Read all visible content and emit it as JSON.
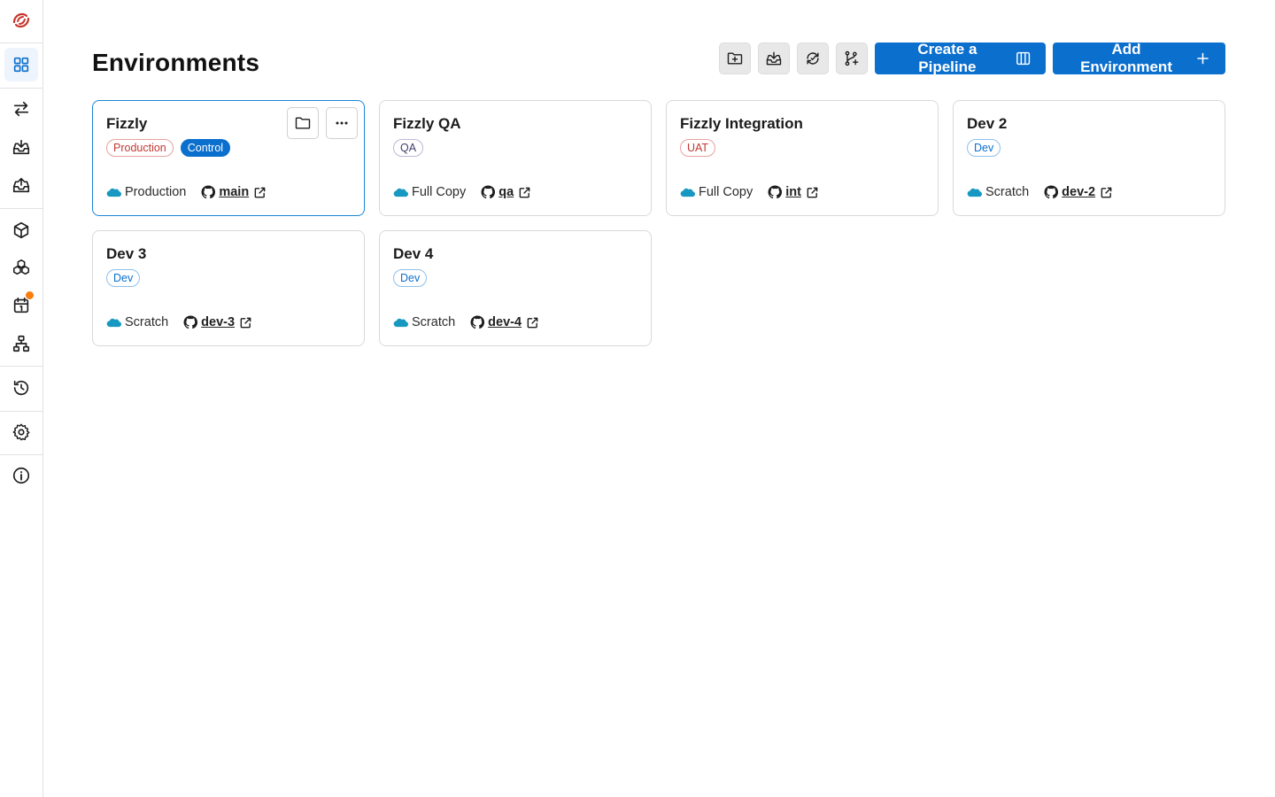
{
  "page": {
    "title": "Environments"
  },
  "sidebar": {
    "items": [
      {
        "name": "environments",
        "icon": "grid-icon",
        "active": true
      },
      {
        "name": "compare",
        "icon": "arrows-swap-icon"
      },
      {
        "name": "retrieve",
        "icon": "inbox-in-icon"
      },
      {
        "name": "deploy",
        "icon": "inbox-out-icon"
      },
      {
        "name": "packages",
        "icon": "cube-icon"
      },
      {
        "name": "bundles",
        "icon": "cubes-icon"
      },
      {
        "name": "schedule",
        "icon": "calendar-icon"
      },
      {
        "name": "pipelines",
        "icon": "hierarchy-icon"
      },
      {
        "name": "history",
        "icon": "history-icon"
      },
      {
        "name": "settings",
        "icon": "gear-icon"
      },
      {
        "name": "info",
        "icon": "info-icon"
      }
    ],
    "notification_color": "#f97d0b"
  },
  "toolbar": {
    "create_pipeline_label": "Create a Pipeline",
    "add_environment_label": "Add Environment"
  },
  "environments": [
    {
      "name": "Fizzly",
      "badges": [
        "Production",
        "Control"
      ],
      "org_type": "Production",
      "branch": "main"
    },
    {
      "name": "Fizzly QA",
      "badges": [
        "QA"
      ],
      "org_type": "Full Copy",
      "branch": "qa"
    },
    {
      "name": "Fizzly Integration",
      "badges": [
        "UAT"
      ],
      "org_type": "Full Copy",
      "branch": "int"
    },
    {
      "name": "Dev 2",
      "badges": [
        "Dev"
      ],
      "org_type": "Scratch",
      "branch": "dev-2"
    },
    {
      "name": "Dev 3",
      "badges": [
        "Dev"
      ],
      "org_type": "Scratch",
      "branch": "dev-3"
    },
    {
      "name": "Dev 4",
      "badges": [
        "Dev"
      ],
      "org_type": "Scratch",
      "branch": "dev-4"
    }
  ],
  "colors": {
    "accent": "#0b6fce",
    "selected_border": "#1b86d6",
    "salesforce_cloud": "#1798c1"
  }
}
